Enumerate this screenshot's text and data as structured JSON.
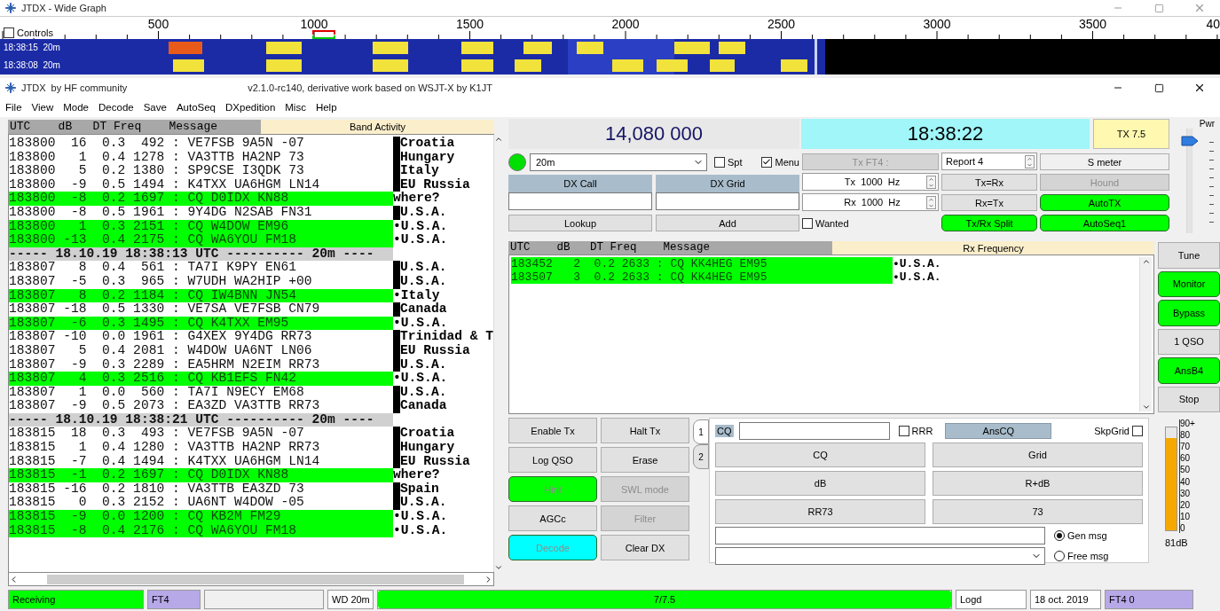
{
  "wide_graph": {
    "title": "JTDX - Wide Graph",
    "controls": {
      "label": "Controls",
      "checked": false
    },
    "scale": [
      "500",
      "1000",
      "1500",
      "2000",
      "2500",
      "3000",
      "3500",
      "40"
    ],
    "rows": [
      {
        "label": "18:38:15  20m"
      },
      {
        "label": "18:38:08  20m"
      }
    ]
  },
  "main_window": {
    "title": "JTDX  by HF community",
    "subtitle": "v2.1.0-rc140, derivative work based on WSJT-X by K1JT"
  },
  "menu": [
    "File",
    "View",
    "Mode",
    "Decode",
    "Save",
    "AutoSeq",
    "DXpedition",
    "Misc",
    "Help"
  ],
  "band_activity": {
    "header": "UTC    dB   DT Freq    Message",
    "title": "Band Activity",
    "rows": [
      {
        "kind": "decode",
        "line": "183800  16  0.3  492 : VE7FSB 9A5N -07",
        "country": "Croatia",
        "highlight": false,
        "bar": true
      },
      {
        "kind": "decode",
        "line": "183800   1  0.4 1278 : VA3TTB HA2NP 73",
        "country": "Hungary",
        "highlight": false,
        "bar": true
      },
      {
        "kind": "decode",
        "line": "183800   5  0.2 1380 : SP9CSE I3QDK 73",
        "country": "Italy",
        "highlight": false,
        "bar": true
      },
      {
        "kind": "decode",
        "line": "183800  -9  0.5 1494 : K4TXX UA6HGM LN14",
        "country": "EU Russia",
        "highlight": false,
        "bar": true
      },
      {
        "kind": "decode",
        "line": "183800  -8  0.2 1697 : CQ D0IDX KN88",
        "country": "where?",
        "highlight": true,
        "bar": false
      },
      {
        "kind": "decode",
        "line": "183800  -8  0.5 1961 : 9Y4DG N2SAB FN31",
        "country": "U.S.A.",
        "highlight": false,
        "bar": true
      },
      {
        "kind": "decode",
        "line": "183800   1  0.3 2151 : CQ W4DOW EM96",
        "country": "•U.S.A.",
        "highlight": true,
        "bar": false
      },
      {
        "kind": "decode",
        "line": "183800 -13  0.4 2175 : CQ WA6YOU FM18",
        "country": "•U.S.A.",
        "highlight": true,
        "bar": false
      },
      {
        "kind": "separator",
        "line": "----- 18.10.19 18:38:13 UTC ---------- 20m ----"
      },
      {
        "kind": "decode",
        "line": "183807   8  0.4  561 : TA7I K9PY EN61",
        "country": "U.S.A.",
        "highlight": false,
        "bar": true
      },
      {
        "kind": "decode",
        "line": "183807  -5  0.3  965 : W7UDH WA2HIP +00",
        "country": "U.S.A.",
        "highlight": false,
        "bar": true
      },
      {
        "kind": "decode",
        "line": "183807   8  0.2 1184 : CQ IW4BNN JN54",
        "country": "•Italy",
        "highlight": true,
        "bar": false
      },
      {
        "kind": "decode",
        "line": "183807 -18  0.5 1330 : VE7SA VE7FSB CN79",
        "country": "Canada",
        "highlight": false,
        "bar": true
      },
      {
        "kind": "decode",
        "line": "183807  -6  0.3 1495 : CQ K4TXX EM95",
        "country": "•U.S.A.",
        "highlight": true,
        "bar": false
      },
      {
        "kind": "decode",
        "line": "183807 -10  0.0 1961 : G4XEX 9Y4DG RR73",
        "country": "Trinidad & T",
        "highlight": false,
        "bar": true
      },
      {
        "kind": "decode",
        "line": "183807   5  0.4 2081 : W4DOW UA6NT LN06",
        "country": "EU Russia",
        "highlight": false,
        "bar": true
      },
      {
        "kind": "decode",
        "line": "183807  -9  0.3 2289 : EA5HRM N2EIM RR73",
        "country": "U.S.A.",
        "highlight": false,
        "bar": true
      },
      {
        "kind": "decode",
        "line": "183807   4  0.3 2516 : CQ KB1EFS FN42",
        "country": "•U.S.A.",
        "highlight": true,
        "bar": false
      },
      {
        "kind": "decode",
        "line": "183807   1  0.0  560 : TA7I N9ECY EM68",
        "country": "U.S.A.",
        "highlight": false,
        "bar": true
      },
      {
        "kind": "decode",
        "line": "183807  -9  0.5 2073 : EA3ZD VA3TTB RR73",
        "country": "Canada",
        "highlight": false,
        "bar": true
      },
      {
        "kind": "separator",
        "line": "----- 18.10.19 18:38:21 UTC ---------- 20m ----"
      },
      {
        "kind": "decode",
        "line": "183815  18  0.3  493 : VE7FSB 9A5N -07",
        "country": "Croatia",
        "highlight": false,
        "bar": true
      },
      {
        "kind": "decode",
        "line": "183815   1  0.4 1280 : VA3TTB HA2NP RR73",
        "country": "Hungary",
        "highlight": false,
        "bar": true
      },
      {
        "kind": "decode",
        "line": "183815  -7  0.4 1494 : K4TXX UA6HGM LN14",
        "country": "EU Russia",
        "highlight": false,
        "bar": true
      },
      {
        "kind": "decode",
        "line": "183815  -1  0.2 1697 : CQ D0IDX KN88",
        "country": "where?",
        "highlight": true,
        "bar": false
      },
      {
        "kind": "decode",
        "line": "183815 -16  0.2 1810 : VA3TTB EA3ZD 73",
        "country": "Spain",
        "highlight": false,
        "bar": true
      },
      {
        "kind": "decode",
        "line": "183815   0  0.3 2152 : UA6NT W4DOW -05",
        "country": "U.S.A.",
        "highlight": false,
        "bar": true
      },
      {
        "kind": "decode",
        "line": "183815  -9  0.0 1200 : CQ KB2M FM29",
        "country": "•U.S.A.",
        "highlight": true,
        "bar": false
      },
      {
        "kind": "decode",
        "line": "183815  -8  0.4 2176 : CQ WA6YOU FM18",
        "country": "•U.S.A.",
        "highlight": true,
        "bar": false
      }
    ]
  },
  "frequency": "14,080 000",
  "clock": "18:38:22",
  "tx_button": "TX 7.5",
  "pwr": {
    "label": "Pwr",
    "level": 0.88
  },
  "band": {
    "value": "20m",
    "indicator_on": true
  },
  "spt": {
    "label": "Spt",
    "checked": false
  },
  "menu_check": {
    "label": "Menu",
    "checked": true
  },
  "dx_call": {
    "label": "DX Call"
  },
  "dx_grid": {
    "label": "DX Grid"
  },
  "lookup": "Lookup",
  "add": "Add",
  "tx_mode": {
    "label": "Tx FT4 :",
    "disabled": true
  },
  "tx_freq": "Tx  1000  Hz",
  "rx_freq": "Rx  1000  Hz",
  "wanted": {
    "label": "Wanted",
    "checked": false
  },
  "report": "Report 4",
  "split_buttons": [
    {
      "label": "Tx=Rx",
      "color": "#e1e1e1",
      "disabled": false
    },
    {
      "label": "Rx=Tx",
      "color": "#e1e1e1",
      "disabled": false
    },
    {
      "label": "Tx/Rx Split",
      "color": "#00ff00",
      "disabled": false
    }
  ],
  "mode_buttons": [
    {
      "label": "S meter",
      "color": "#f0f0f0",
      "disabled": false
    },
    {
      "label": "Hound",
      "color": "#d4d4d4",
      "disabled": true
    },
    {
      "label": "AutoTX",
      "color": "#00ff00",
      "disabled": false
    },
    {
      "label": "AutoSeq1",
      "color": "#00ff00",
      "disabled": false
    }
  ],
  "rx_frequency": {
    "header": "UTC    dB   DT Freq    Message",
    "title": "Rx Frequency",
    "rows": [
      {
        "line": "183452   2  0.2 2633 : CQ KK4HEG EM95",
        "country": "•U.S.A.",
        "highlight": true
      },
      {
        "line": "183507   3  0.2 2633 : CQ KK4HEG EM95",
        "country": "•U.S.A.",
        "highlight": true
      }
    ]
  },
  "side_buttons": [
    {
      "label": "Tune",
      "color": "#e1e1e1",
      "disabled": false
    },
    {
      "label": "Monitor",
      "color": "#00ff00",
      "disabled": false
    },
    {
      "label": "Bypass",
      "color": "#00ff00",
      "disabled": false
    },
    {
      "label": "1 QSO",
      "color": "#e1e1e1",
      "disabled": false
    },
    {
      "label": "AnsB4",
      "color": "#00ff00",
      "disabled": false
    },
    {
      "label": "Stop",
      "color": "#e1e1e1",
      "disabled": false
    }
  ],
  "control_buttons": [
    {
      "label": "Enable Tx",
      "color": "#e1e1e1",
      "disabled": false
    },
    {
      "label": "Halt Tx",
      "color": "#e1e1e1",
      "disabled": false
    },
    {
      "label": "Log QSO",
      "color": "#e1e1e1",
      "disabled": false
    },
    {
      "label": "Erase",
      "color": "#e1e1e1",
      "disabled": false
    },
    {
      "label": "Hint",
      "color": "#00ff00",
      "disabled": true
    },
    {
      "label": "SWL mode",
      "color": "#d4d4d4",
      "disabled": true
    },
    {
      "label": "AGCc",
      "color": "#e1e1e1",
      "disabled": false
    },
    {
      "label": "Filter",
      "color": "#d4d4d4",
      "disabled": true
    },
    {
      "label": "Decode",
      "color": "#00ffff",
      "disabled": true
    },
    {
      "label": "Clear DX",
      "color": "#e1e1e1",
      "disabled": false
    }
  ],
  "tabs": [
    {
      "label": "1",
      "selected": true
    },
    {
      "label": "2",
      "selected": false
    }
  ],
  "tx_panel": {
    "cq_label": "CQ",
    "rrr": {
      "label": "RRR",
      "checked": false
    },
    "anscq": "AnsCQ",
    "skpgrid": {
      "label": "SkpGrid",
      "checked": false
    },
    "messages": [
      "CQ",
      "Grid",
      "dB",
      "R+dB",
      "RR73",
      "73"
    ],
    "gen_msg": {
      "label": "Gen msg",
      "selected": true
    },
    "free_msg": {
      "label": "Free msg",
      "selected": false
    }
  },
  "meter": {
    "level": 0.9,
    "reading": "81dB",
    "scale": [
      "90+",
      "80",
      "70",
      "60",
      "50",
      "40",
      "30",
      "20",
      "10",
      "0"
    ]
  },
  "status_bar": {
    "state": "Receiving",
    "mode": "FT4",
    "band": "WD 20m",
    "progress": {
      "text": "7/7.5",
      "level": 1
    },
    "log": "Logd",
    "date": "18 oct. 2019",
    "tx_mode": "FT4 0"
  }
}
